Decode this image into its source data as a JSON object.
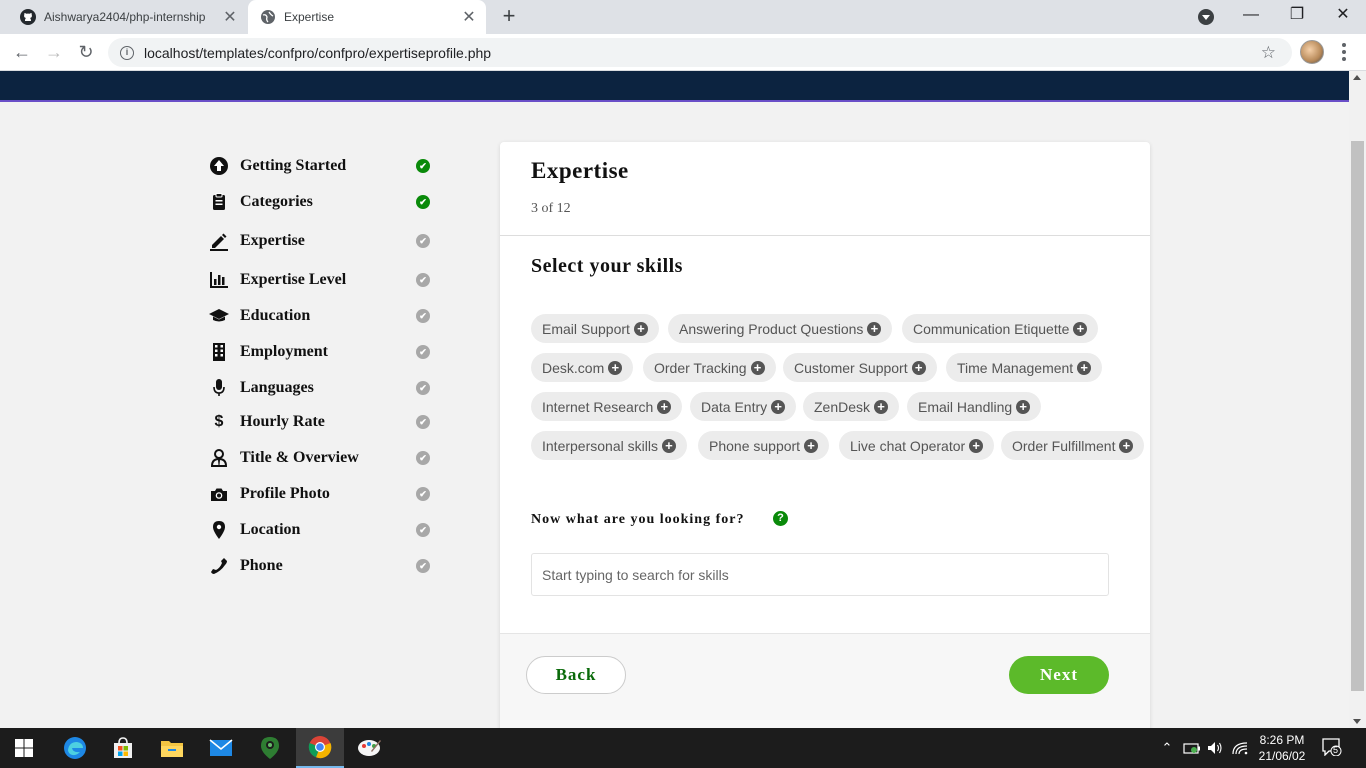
{
  "browser": {
    "tabs": [
      {
        "title": "Aishwarya2404/php-internship",
        "icon": "github-icon"
      },
      {
        "title": "Expertise",
        "icon": "globe-icon"
      }
    ],
    "url": "localhost/templates/confpro/confpro/expertiseprofile.php"
  },
  "steps": [
    {
      "label": "Getting Started",
      "icon": "arrow-up-circle-icon",
      "status": "done"
    },
    {
      "label": "Categories",
      "icon": "clipboard-icon",
      "status": "done"
    },
    {
      "label": "Expertise",
      "icon": "pen-icon",
      "status": "pending"
    },
    {
      "label": "Expertise Level",
      "icon": "bar-chart-icon",
      "status": "pending"
    },
    {
      "label": "Education",
      "icon": "graduation-cap-icon",
      "status": "pending"
    },
    {
      "label": "Employment",
      "icon": "building-icon",
      "status": "pending"
    },
    {
      "label": "Languages",
      "icon": "microphone-icon",
      "status": "pending"
    },
    {
      "label": "Hourly Rate",
      "icon": "dollar-icon",
      "status": "pending"
    },
    {
      "label": "Title & Overview",
      "icon": "user-tie-icon",
      "status": "pending"
    },
    {
      "label": "Profile Photo",
      "icon": "camera-icon",
      "status": "pending"
    },
    {
      "label": "Location",
      "icon": "map-pin-icon",
      "status": "pending"
    },
    {
      "label": "Phone",
      "icon": "phone-icon",
      "status": "pending"
    }
  ],
  "card": {
    "title": "Expertise",
    "progress": "3 of 12",
    "section_title": "Select your skills",
    "skills": [
      "Email Support",
      "Answering Product Questions",
      "Communication Etiquette",
      "Desk.com",
      "Order Tracking",
      "Customer Support",
      "Time Management",
      "Internet Research",
      "Data Entry",
      "ZenDesk",
      "Email Handling",
      "Interpersonal skills",
      "Phone support",
      "Live chat Operator",
      "Order Fulfillment"
    ],
    "lookfor_label": "Now what are you looking for?",
    "search_placeholder": "Start typing to search for skills",
    "back_label": "Back",
    "next_label": "Next"
  },
  "taskbar": {
    "time": "8:26 PM",
    "date": "21/06/02",
    "notifications": "5"
  },
  "colors": {
    "header": "#0c2340",
    "done": "#0a8a0a",
    "pending": "#a8a8a8",
    "next_button": "#5cba2a"
  }
}
